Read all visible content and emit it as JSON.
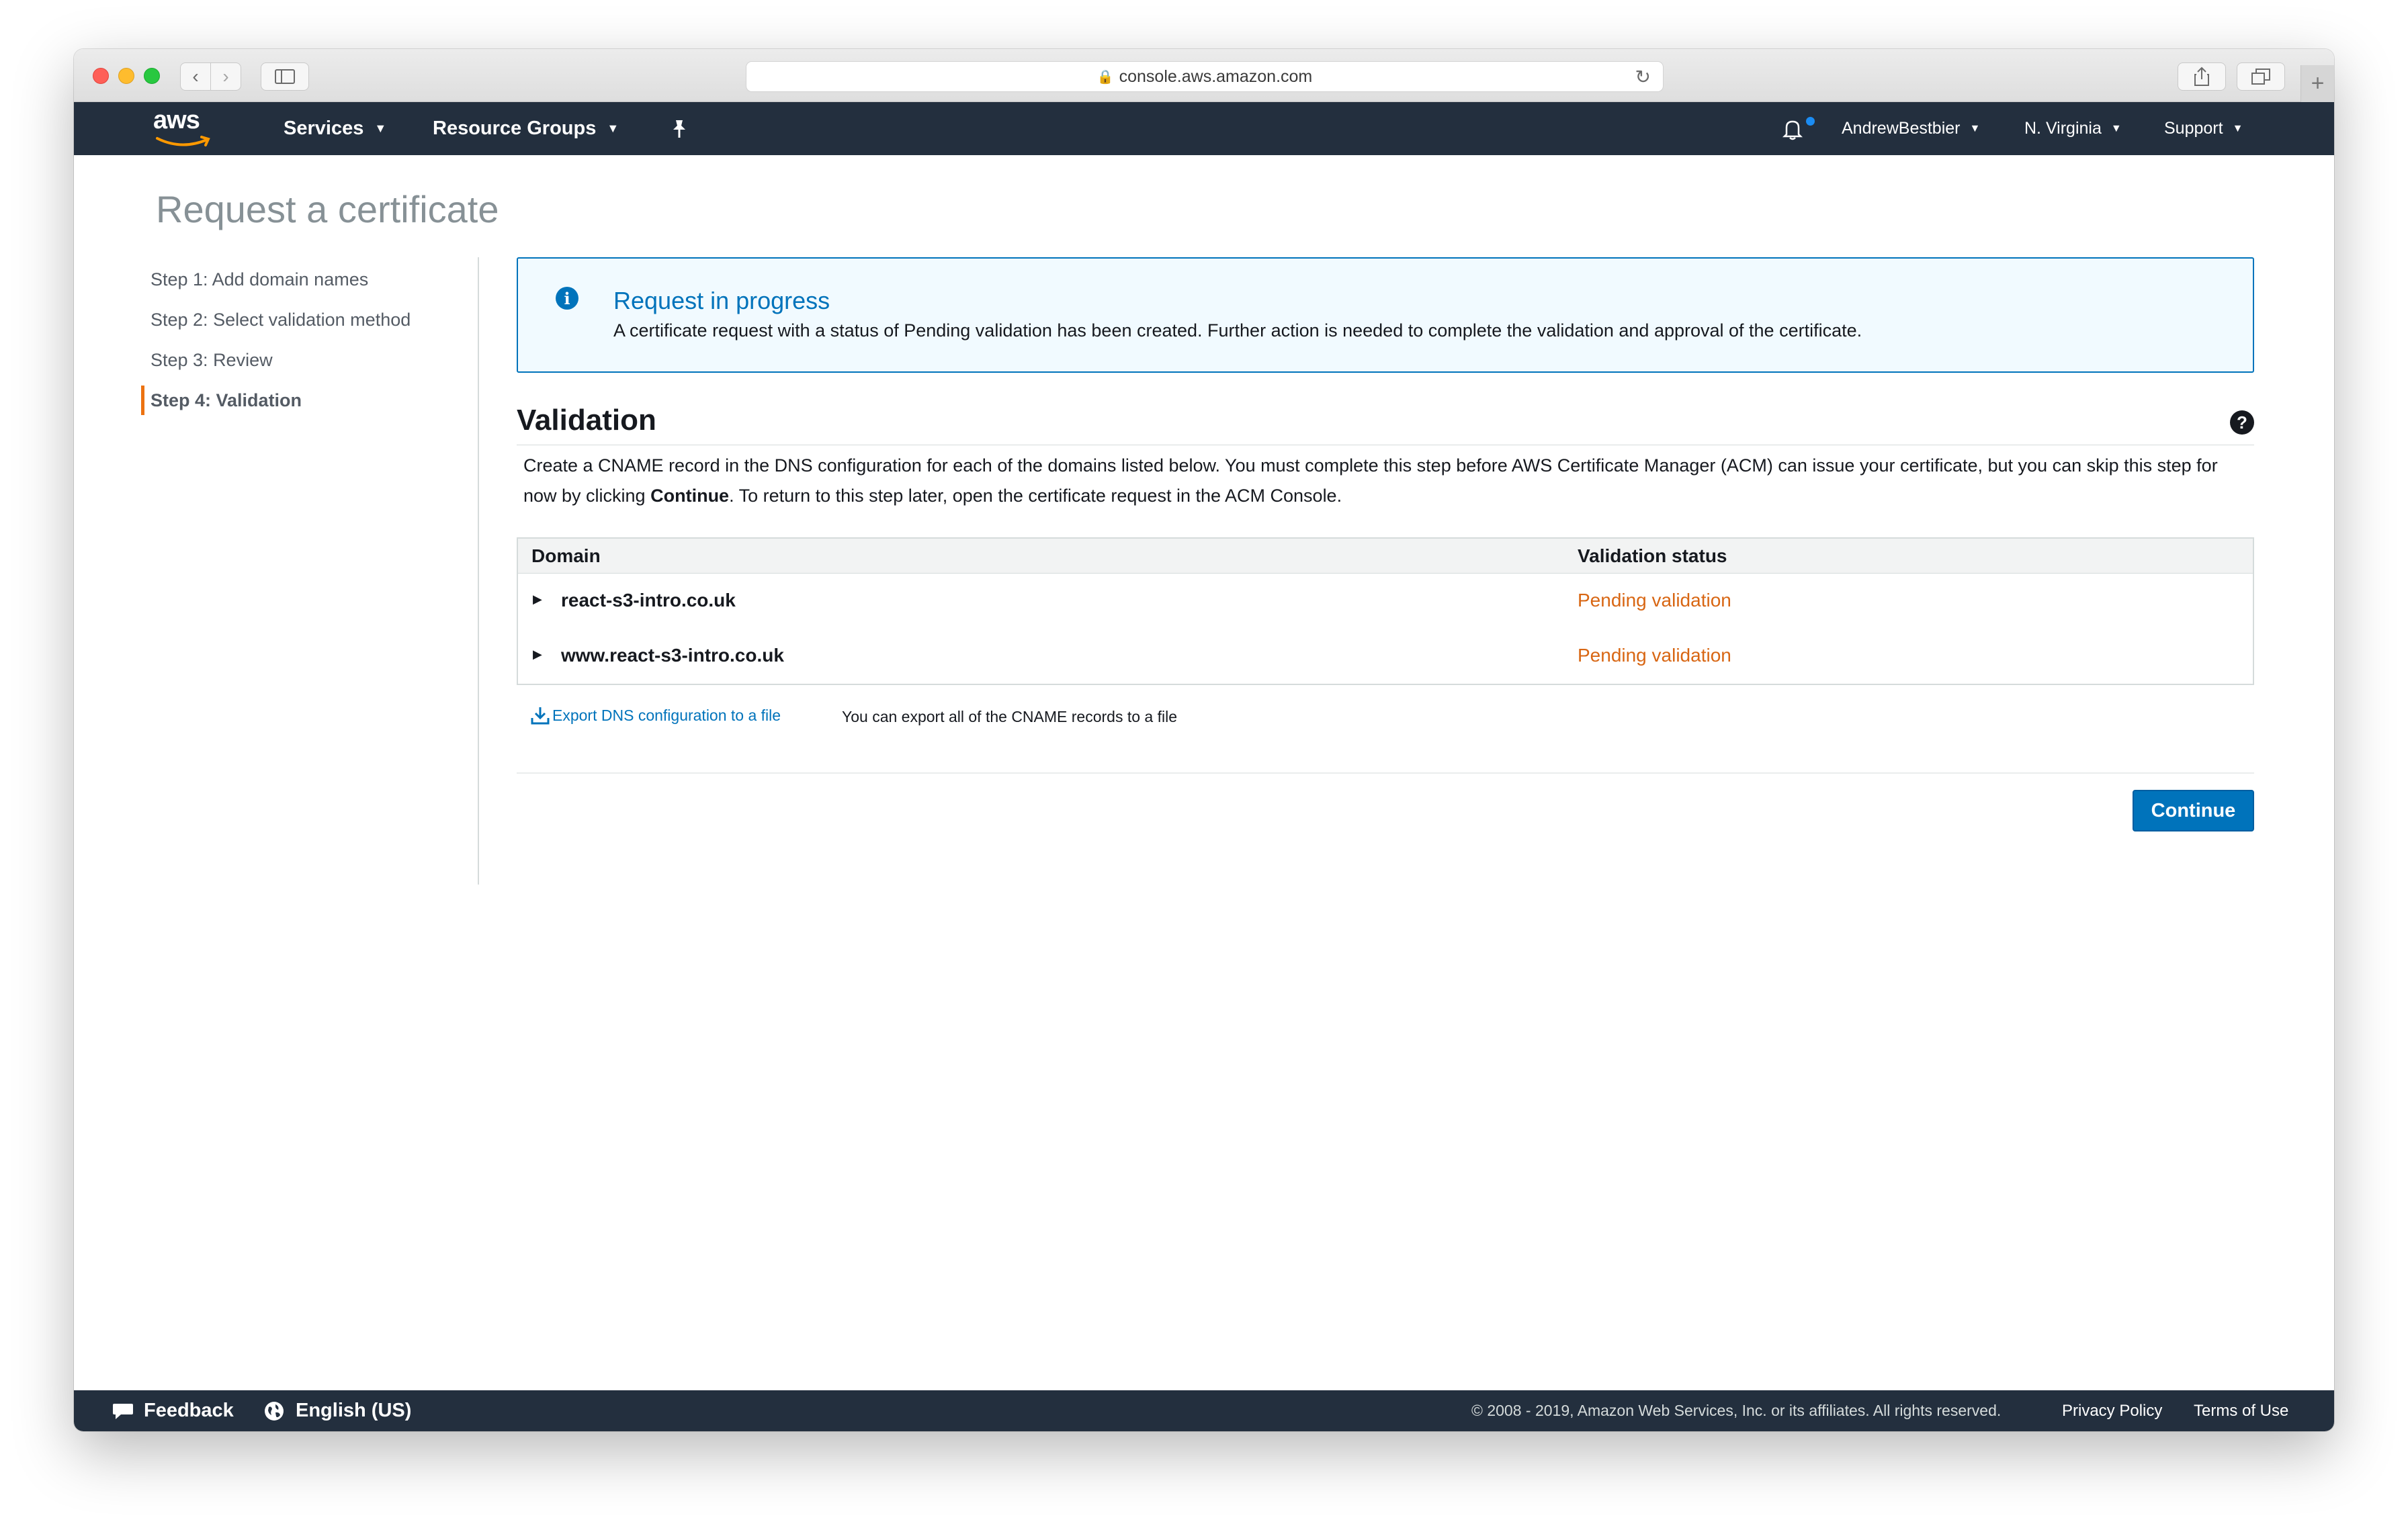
{
  "browser": {
    "url": "console.aws.amazon.com"
  },
  "nav": {
    "logo": "aws",
    "services": "Services",
    "resource_groups": "Resource Groups",
    "user": "AndrewBestbier",
    "region": "N. Virginia",
    "support": "Support"
  },
  "page": {
    "title": "Request a certificate"
  },
  "steps": [
    {
      "label": "Step 1: Add domain names"
    },
    {
      "label": "Step 2: Select validation method"
    },
    {
      "label": "Step 3: Review"
    },
    {
      "label": "Step 4: Validation"
    }
  ],
  "info": {
    "title": "Request in progress",
    "text": "A certificate request with a status of Pending validation has been created. Further action is needed to complete the validation and approval of the certificate."
  },
  "validation": {
    "title": "Validation",
    "desc_part1": "Create a CNAME record in the DNS configuration for each of the domains listed below. You must complete this step before AWS Certificate Manager (ACM) can issue your certificate, but you can skip this step for now by clicking ",
    "desc_bold": "Continue",
    "desc_part2": ". To return to this step later, open the certificate request in the ACM Console.",
    "columns": [
      "Domain",
      "Validation status"
    ],
    "rows": [
      {
        "domain": "react-s3-intro.co.uk",
        "status": "Pending validation"
      },
      {
        "domain": "www.react-s3-intro.co.uk",
        "status": "Pending validation"
      }
    ],
    "export_link": "Export DNS configuration to a file",
    "export_help": "You can export all of the CNAME records to a file",
    "continue": "Continue"
  },
  "footer": {
    "feedback": "Feedback",
    "language": "English (US)",
    "copyright": "© 2008 - 2019, Amazon Web Services, Inc. or its affiliates. All rights reserved.",
    "privacy": "Privacy Policy",
    "terms": "Terms of Use"
  },
  "colors": {
    "nav_bg": "#232f3e",
    "link_blue": "#0073bb",
    "pending_orange": "#d86613",
    "active_step_bar": "#ec7211"
  }
}
